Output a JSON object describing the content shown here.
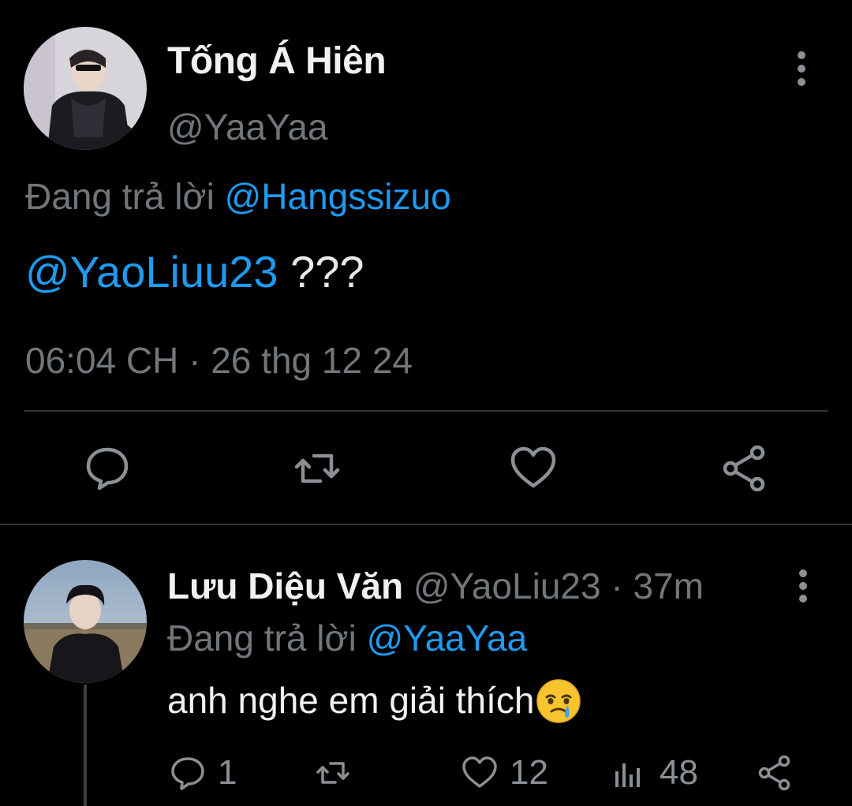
{
  "main_tweet": {
    "author_name": "Tống Á Hiên",
    "author_handle": "@YaaYaa",
    "replying_prefix": "Đang trả lời",
    "replying_to": "@Hangssizuo",
    "mention": "@YaoLiuu23",
    "text": "???",
    "timestamp": "06:04 CH · 26 thg 12 24"
  },
  "reply_tweet": {
    "author_name": "Lưu Diệu Văn",
    "author_handle": "@YaoLiu23",
    "separator": "·",
    "time_ago": "37m",
    "replying_prefix": "Đang trả lời",
    "replying_to": "@YaaYaa",
    "text": "anh nghe em giải thích",
    "reply_count": "1",
    "like_count": "12",
    "view_count": "48"
  },
  "icons": {
    "reply": "speech-bubble-icon",
    "retweet": "retweet-icon",
    "like": "heart-icon",
    "share": "share-icon",
    "views": "bar-chart-icon",
    "more": "vertical-ellipsis-icon",
    "emoji": "face-holding-back-tears-emoji"
  },
  "colors": {
    "background": "#000000",
    "link": "#1d9bf0",
    "secondary_text": "#71767b",
    "primary_text": "#e7e9ea"
  }
}
